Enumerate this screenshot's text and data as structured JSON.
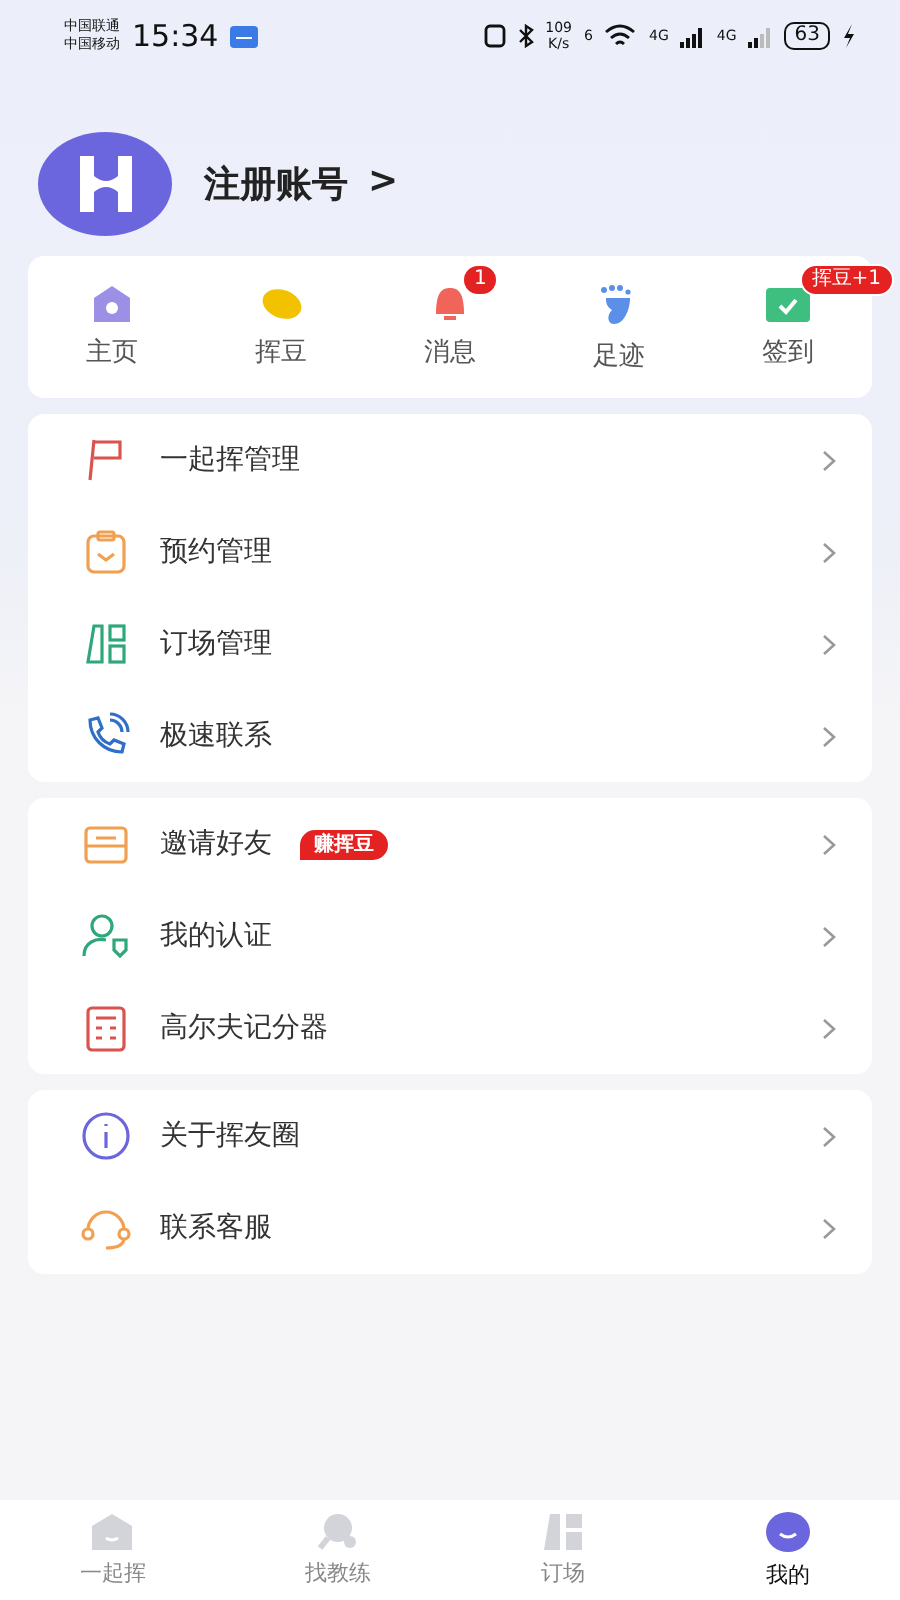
{
  "status_bar": {
    "carriers": [
      "中国联通",
      "中国移动"
    ],
    "time": "15:34",
    "speed": "109",
    "speed_unit": "K/s",
    "wifi_label": "6",
    "network_1": "4G",
    "network_2": "4G",
    "battery": "63"
  },
  "profile": {
    "name": "注册账号",
    "arrow": ">"
  },
  "quick_links": [
    {
      "label": "主页"
    },
    {
      "label": "挥豆"
    },
    {
      "label": "消息",
      "badge": "1"
    },
    {
      "label": "足迹"
    },
    {
      "label": "签到",
      "badge": "挥豆+1"
    }
  ],
  "menu_groups": [
    {
      "items": [
        {
          "label": "一起挥管理"
        },
        {
          "label": "预约管理"
        },
        {
          "label": "订场管理"
        },
        {
          "label": "极速联系"
        }
      ]
    },
    {
      "items": [
        {
          "label": "邀请好友",
          "tag": "赚挥豆"
        },
        {
          "label": "我的认证"
        },
        {
          "label": "高尔夫记分器"
        }
      ]
    },
    {
      "items": [
        {
          "label": "关于挥友圈"
        },
        {
          "label": "联系客服"
        }
      ]
    }
  ],
  "tab_bar": [
    {
      "label": "一起挥",
      "selected": false
    },
    {
      "label": "找教练",
      "selected": false
    },
    {
      "label": "订场",
      "selected": false
    },
    {
      "label": "我的",
      "selected": true
    }
  ]
}
